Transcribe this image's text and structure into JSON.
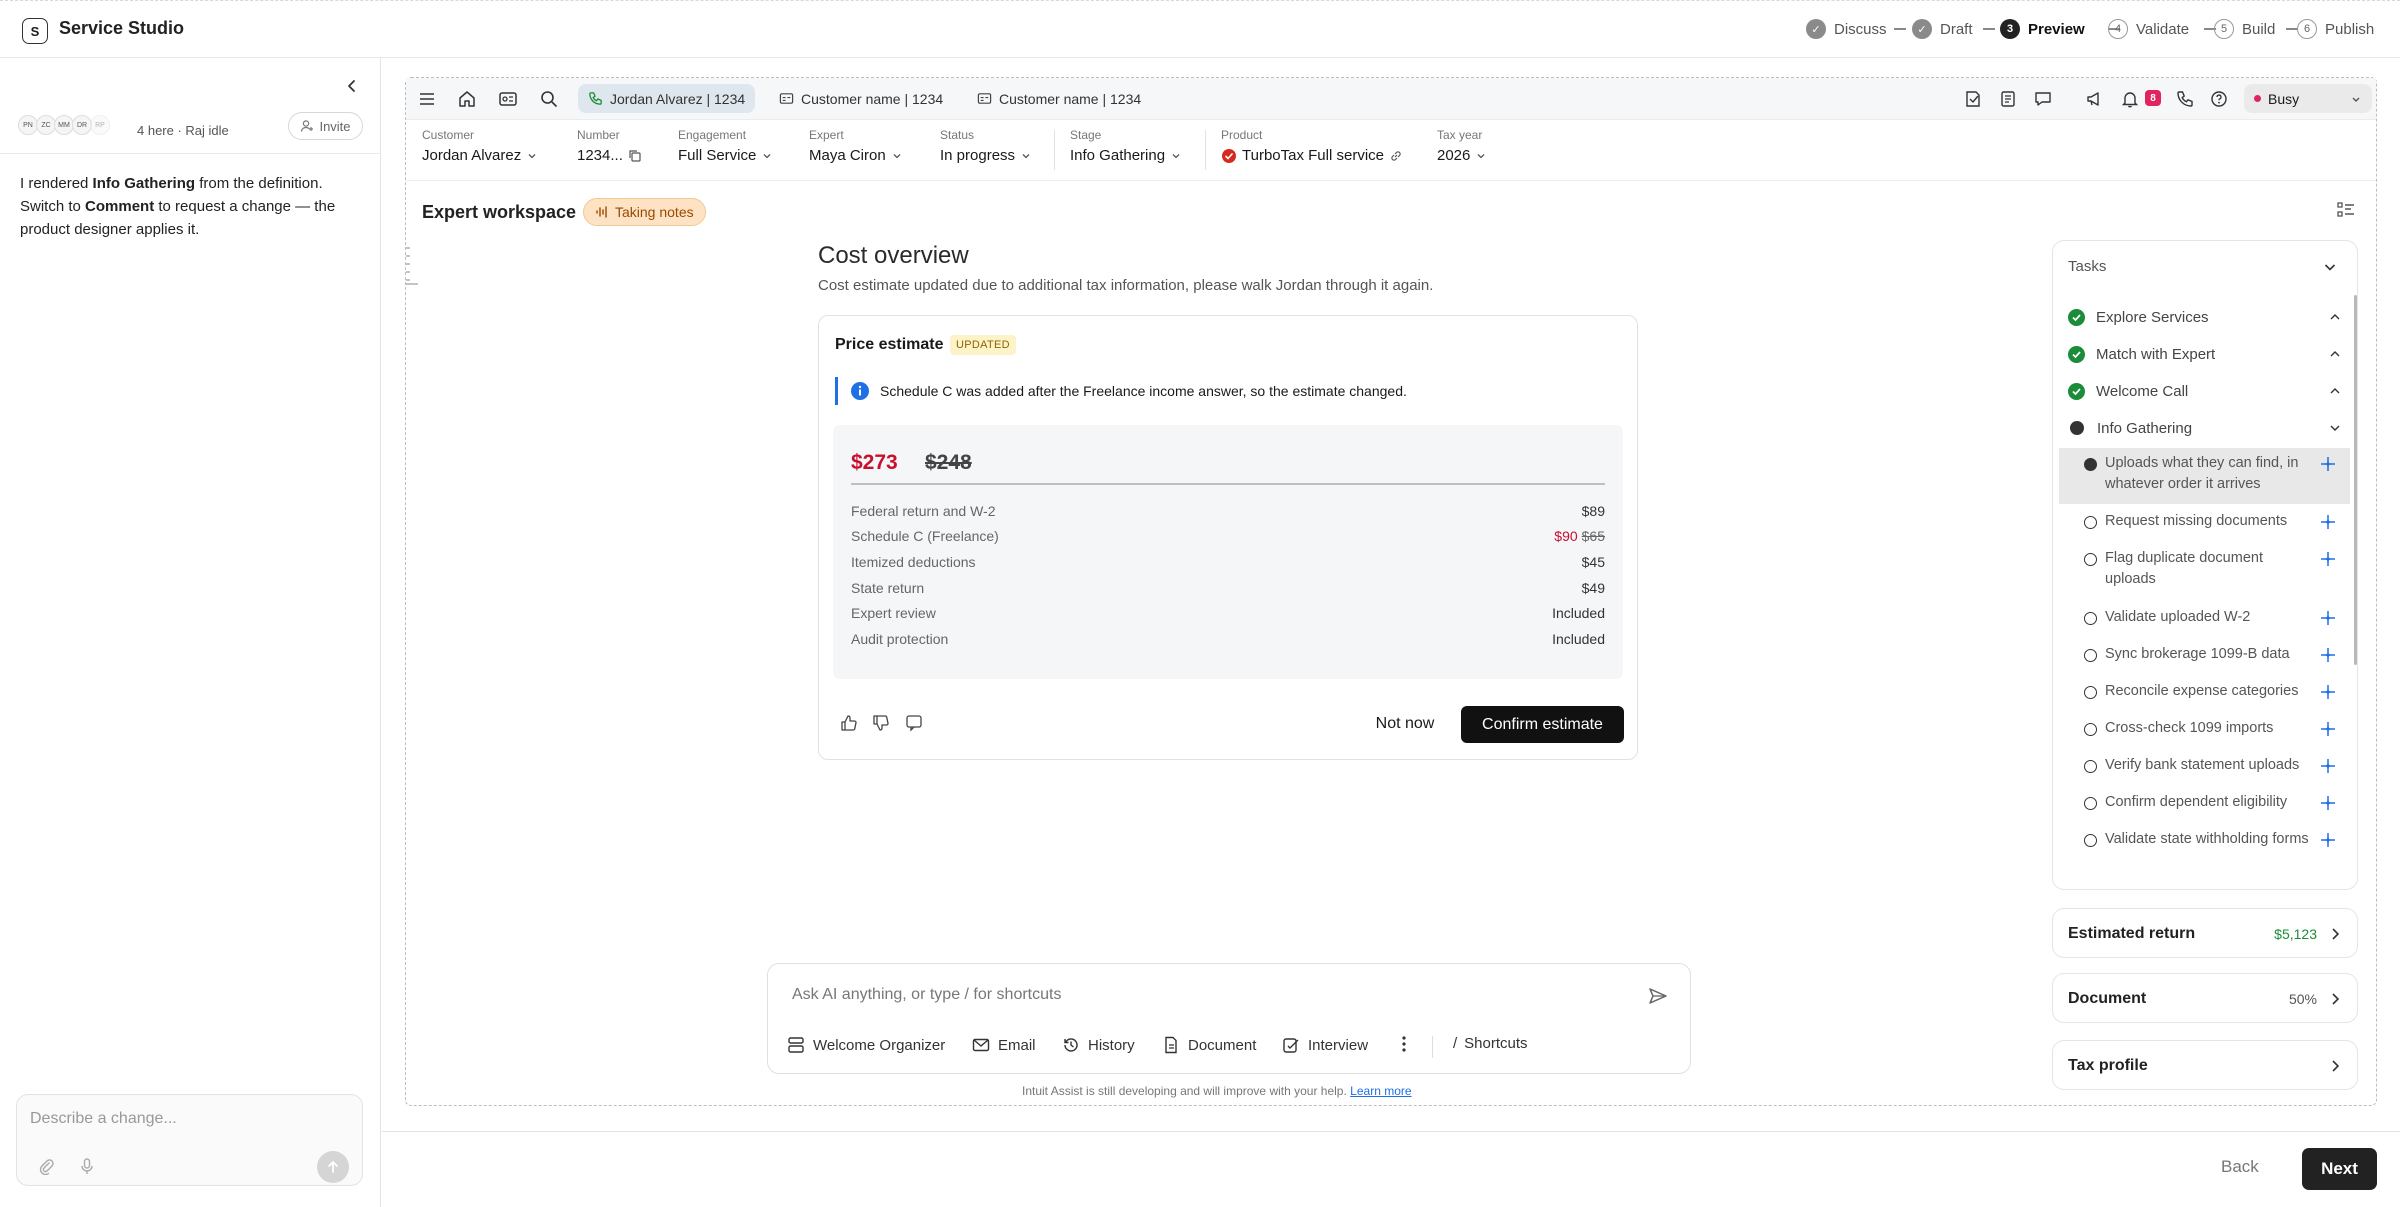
{
  "app": {
    "logo_letter": "S",
    "title": "Service Studio"
  },
  "steps": [
    {
      "num": "✓",
      "label": "Discuss",
      "state": "done"
    },
    {
      "num": "✓",
      "label": "Draft",
      "state": "done"
    },
    {
      "num": "3",
      "label": "Preview",
      "state": "current"
    },
    {
      "num": "4",
      "label": "Validate",
      "state": "todo"
    },
    {
      "num": "5",
      "label": "Build",
      "state": "todo"
    },
    {
      "num": "6",
      "label": "Publish",
      "state": "todo"
    }
  ],
  "left": {
    "avatars": [
      "PN",
      "ZC",
      "MM",
      "DR",
      "RP"
    ],
    "presence": "4 here · Raj idle",
    "invite": "Invite",
    "msg": {
      "p1": "I rendered ",
      "b1": "Info Gathering",
      "p2": " from the definition. Switch to ",
      "b2": "Comment",
      "p3": " to request a change — the product designer applies it."
    },
    "describe_placeholder": "Describe a change..."
  },
  "toolbar": {
    "chips": [
      "Jordan Alvarez | 1234",
      "Customer name | 1234",
      "Customer name | 1234"
    ],
    "badge_count": "8",
    "status": "Busy"
  },
  "meta": [
    {
      "label": "Customer",
      "value": "Jordan Alvarez"
    },
    {
      "label": "Number",
      "value": "1234..."
    },
    {
      "label": "Engagement",
      "value": "Full Service"
    },
    {
      "label": "Expert",
      "value": "Maya Ciron"
    },
    {
      "label": "Status",
      "value": "In progress"
    },
    {
      "label": "Stage",
      "value": "Info Gathering"
    },
    {
      "label": "Product",
      "value": "TurboTax Full service"
    },
    {
      "label": "Tax year",
      "value": "2026"
    }
  ],
  "workspace": {
    "title": "Expert workspace",
    "badge": "Taking notes"
  },
  "cost": {
    "title": "Cost overview",
    "subtitle": "Cost estimate updated due to additional tax information, please walk Jordan through it again.",
    "card_title": "Price estimate",
    "badge": "UPDATED",
    "info": "Schedule C was added after the Freelance income answer, so the estimate changed.",
    "new_price": "$273",
    "old_price": "$248",
    "rows": [
      {
        "label": "Federal return and W-2",
        "value": "$89"
      },
      {
        "label": "Schedule C (Freelance)",
        "new": "$90",
        "old": "$65"
      },
      {
        "label": "Itemized deductions",
        "value": "$45"
      },
      {
        "label": "State return",
        "value": "$49"
      },
      {
        "label": "Expert review",
        "value": "Included"
      },
      {
        "label": "Audit protection",
        "value": "Included"
      }
    ],
    "not_now": "Not now",
    "confirm": "Confirm estimate"
  },
  "ask": {
    "placeholder": "Ask AI anything, or type / for shortcuts",
    "tools": [
      "Welcome Organizer",
      "Email",
      "History",
      "Document",
      "Interview"
    ],
    "shortcuts": "Shortcuts",
    "disclaimer": "Intuit Assist is still developing and will improve with your help.",
    "learn_more": "Learn more"
  },
  "tasks": {
    "header": "Tasks",
    "stages": [
      {
        "label": "Explore Services",
        "state": "done"
      },
      {
        "label": "Match with Expert",
        "state": "done"
      },
      {
        "label": "Welcome Call",
        "state": "done"
      },
      {
        "label": "Info Gathering",
        "state": "current"
      }
    ],
    "subtasks": [
      "Uploads what they can find, in whatever order it arrives",
      "Request missing documents",
      "Flag duplicate document uploads",
      "Validate uploaded W-2",
      "Sync brokerage 1099-B data",
      "Reconcile expense categories",
      "Cross-check 1099 imports",
      "Verify bank statement uploads",
      "Confirm dependent eligibility",
      "Validate state withholding forms"
    ]
  },
  "summary": [
    {
      "label": "Estimated return",
      "value": "$5,123"
    },
    {
      "label": "Document",
      "value": "50%"
    },
    {
      "label": "Tax profile",
      "value": ""
    }
  ],
  "footer": {
    "back": "Back",
    "next": "Next"
  },
  "colors": {
    "accent": "#1f6fe5",
    "price_red": "#c8102e",
    "success": "#1a8c3a",
    "badge_pink": "#e0245e"
  }
}
